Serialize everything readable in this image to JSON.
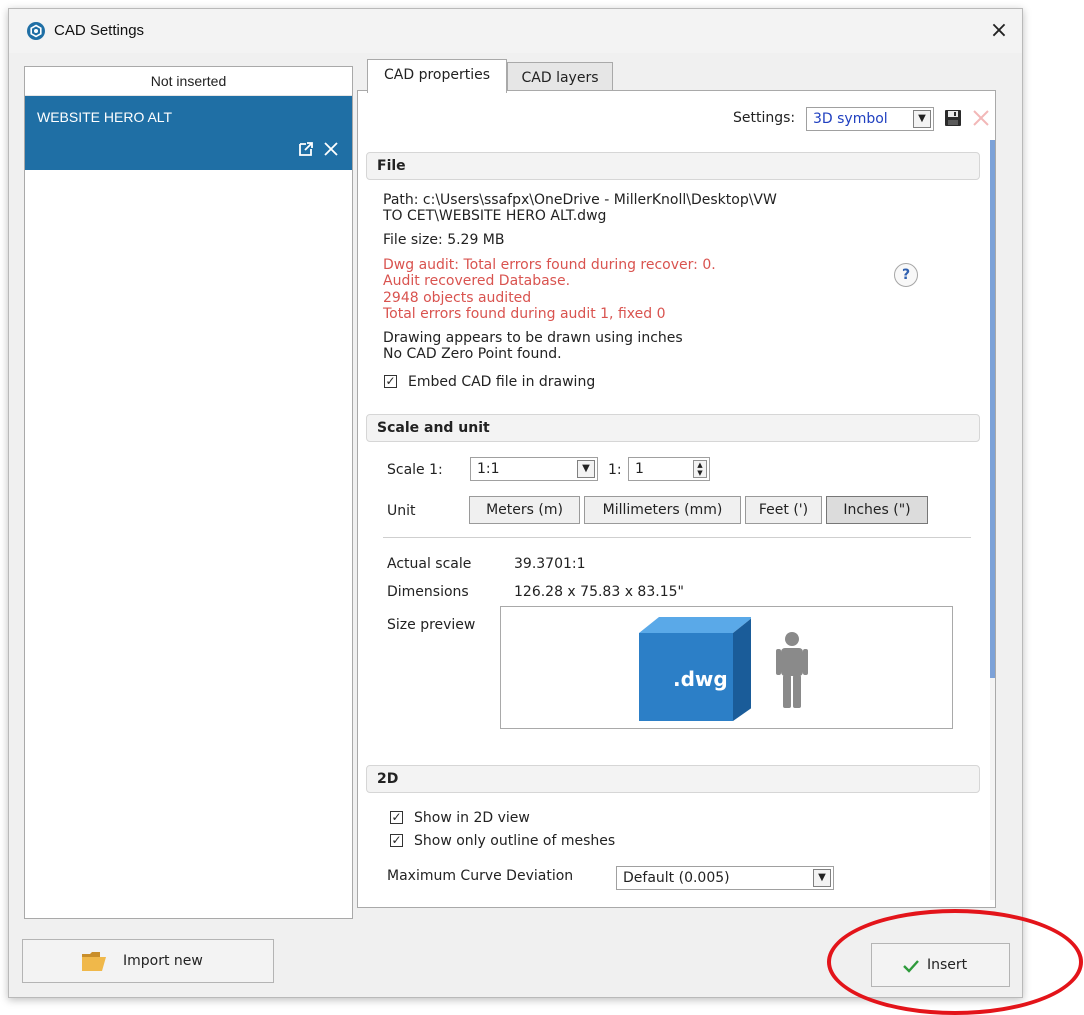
{
  "window": {
    "title": "CAD Settings",
    "close_glyph": "×"
  },
  "left_panel": {
    "header": "Not inserted",
    "items": [
      {
        "name": "WEBSITE HERO ALT"
      }
    ]
  },
  "tabs": [
    {
      "label": "CAD properties",
      "active": true
    },
    {
      "label": "CAD layers",
      "active": false
    }
  ],
  "settings": {
    "label": "Settings:",
    "value": "3D symbol"
  },
  "file": {
    "title": "File",
    "path_line1": "Path: c:\\Users\\ssafpx\\OneDrive - MillerKnoll\\Desktop\\VW",
    "path_line2": "TO CET\\WEBSITE HERO ALT.dwg",
    "size": "File size: 5.29 MB",
    "audit_lines": [
      "Dwg audit: Total errors found during recover: 0.",
      "Audit recovered Database.",
      "2948 objects audited",
      "Total errors found during audit 1, fixed 0"
    ],
    "drawn_units": "Drawing appears to be drawn using inches",
    "zero_point": "No CAD Zero Point found.",
    "embed_label": "Embed CAD file in drawing",
    "embed_checked": true,
    "help_glyph": "?"
  },
  "scale_unit": {
    "title": "Scale and unit",
    "scale_label": "Scale 1:",
    "scale_value": "1:1",
    "ratio_label": "1:",
    "ratio_value": "1",
    "unit_label": "Unit",
    "units": [
      {
        "label": "Meters (m)",
        "selected": false
      },
      {
        "label": "Millimeters (mm)",
        "selected": false
      },
      {
        "label": "Feet (')",
        "selected": false
      },
      {
        "label": "Inches (\")",
        "selected": true
      }
    ],
    "actual_scale_label": "Actual scale",
    "actual_scale_value": "39.3701:1",
    "dimensions_label": "Dimensions",
    "dimensions_value": "126.28 x 75.83 x 83.15\"",
    "size_preview_label": "Size preview",
    "preview_file_label": ".dwg"
  },
  "two_d": {
    "title": "2D",
    "show_2d_label": "Show in 2D view",
    "show_2d_checked": true,
    "outline_label": "Show only outline of meshes",
    "outline_checked": true,
    "curve_label": "Maximum Curve Deviation",
    "curve_value": "Default (0.005)"
  },
  "buttons": {
    "import_new": "Import new",
    "insert": "Insert"
  },
  "colors": {
    "accent": "#1f6fa5",
    "audit_text": "#d9534f",
    "annotation": "#e3141a",
    "scrollbar": "#7da2d8"
  }
}
